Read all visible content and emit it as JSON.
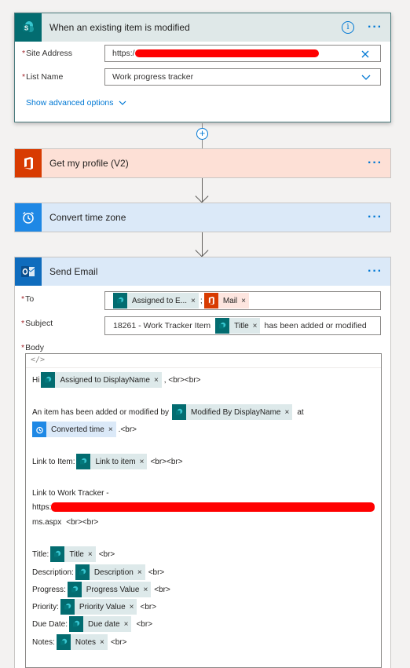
{
  "trigger": {
    "title": "When an existing item is modified",
    "site_address_label": "Site Address",
    "site_address_value": "https:/",
    "list_name_label": "List Name",
    "list_name_value": "Work progress tracker",
    "advanced_label": "Show advanced options",
    "info_glyph": "i",
    "menu_glyph": "···"
  },
  "add_step_glyph": "+",
  "profile_step": {
    "title": "Get my profile (V2)",
    "menu_glyph": "···"
  },
  "timezone_step": {
    "title": "Convert time zone",
    "menu_glyph": "···"
  },
  "email_step": {
    "title": "Send Email",
    "menu_glyph": "···",
    "to_label": "To",
    "to_token_1": "Assigned to E...",
    "to_separator": ";",
    "to_token_2": "Mail",
    "subject_label": "Subject",
    "subject_prefix": "18261 - Work Tracker Item",
    "subject_token": "Title",
    "subject_suffix": "has been added or modified",
    "body_label": "Body",
    "code_glyph": "</>",
    "token_close": "×",
    "body": {
      "hi": "Hi",
      "tok_assigned_display": "Assigned to DisplayName",
      "after_assigned": ", <br><br>",
      "added_text": "An item has been added or modified by",
      "tok_modified_by": "Modified By DisplayName",
      "at": "at",
      "tok_converted_time": "Converted time",
      "after_converted": ".<br>",
      "link_item_label": "Link to Item:",
      "tok_link_item": "Link to item",
      "after_link_item": "<br><br>",
      "link_tracker_label": "Link to Work Tracker -",
      "tracker_url_start": "https:",
      "tracker_url_end": "ms.aspx",
      "after_tracker": "<br><br>",
      "title_label": "Title:",
      "tok_title": "Title",
      "desc_label": "Description:",
      "tok_desc": "Description",
      "progress_label": "Progress:",
      "tok_progress": "Progress Value",
      "priority_label": "Priority:",
      "tok_priority": "Priority Value",
      "due_label": "Due Date:",
      "tok_due": "Due date",
      "notes_label": "Notes:",
      "tok_notes": "Notes",
      "br": "<br>"
    }
  },
  "colors": {
    "sharepoint": "#036c70",
    "office": "#d83b01",
    "schedule": "#1e88e5",
    "outlook": "#0f6cbd",
    "trigger_header": "#dfe8e8",
    "office_header": "#fde0d6",
    "blue_header": "#dbe9f8"
  }
}
